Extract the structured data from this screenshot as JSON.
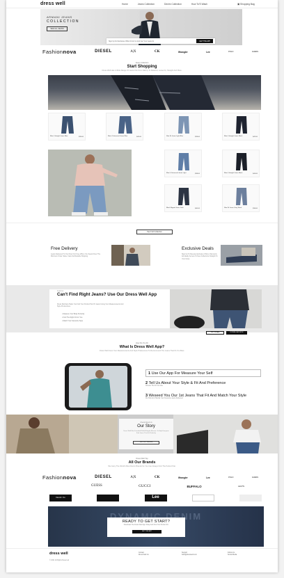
{
  "header": {
    "logo": "dress well",
    "nav": [
      "Home",
      "Jeans Collection",
      "Denim Collection",
      "How To'S Wash"
    ],
    "cart": "Shopping Bag"
  },
  "hero": {
    "subtitle": "ARMANI JEANS",
    "title": "COLLECTION",
    "button": "SEE ALL JEANS",
    "promo_text": "Sign Up For Exclusive Offers From Us And Get Your Jeans At",
    "promo_button": "GET THE APP"
  },
  "brands_row1": [
    "Fashion",
    "nova",
    "DIESEL",
    "A|X",
    "CK",
    "Wrangler",
    "Lee",
    "POLO",
    "GUESS"
  ],
  "start_shopping": {
    "label": "Jeans Collection",
    "title": "Start Shopping",
    "desc": "Dress Well Has A Wide Range Of Jeans Fits From Skinny To Relaxed, Loose Fit, Straight And More."
  },
  "products_top": [
    {
      "name": "Men's Straight Jeans Blue",
      "price": "$35.00"
    },
    {
      "name": "Men's Distressed Jeans Blue",
      "price": "$45.00"
    },
    {
      "name": "Slim Fit Jeans Light Blue",
      "price": "$39.00"
    },
    {
      "name": "Men's Straight Jeans Black",
      "price": "$42.00"
    }
  ],
  "products_side": [
    {
      "name": "Men's Distressed Jeans Light",
      "price": "$38.00"
    },
    {
      "name": "Men's Straight Jeans Black",
      "price": "$44.00"
    },
    {
      "name": "Black Ripped Jeans Dark",
      "price": "$40.00"
    },
    {
      "name": "Slim Fit Jeans Grey Wash",
      "price": "$36.00"
    }
  ],
  "see_collection": "See Full Collection",
  "features": [
    {
      "title": "Free Delivery",
      "desc": "Jeans Delivered To Your Door For Free When You Spend Over The Minimum Order Value. Fast And Reliable Shipping."
    },
    {
      "title": "Exclusive Deals",
      "desc": "Sign Up To Receive Exclusive Offers, Discounts And Early Access To New Collections Straight To Your Inbox."
    }
  ],
  "app": {
    "label": "Features",
    "title": "Can't Find Right Jeans? Use Our Dress Well App",
    "desc": "Dress Well App Helps You Find Your Perfect Pair Of Jeans Using Your Measurements And Style Preferences.",
    "bullets": [
      "Measure Your Body Perfectly",
      "Find The Right Fit For You",
      "Match Your Favourite Style"
    ],
    "store_btn1": "Get The App",
    "store_btn2": "DOWNLOAD NOW"
  },
  "how": {
    "label": "How Do You Fit",
    "title": "What Is Dress Well App?",
    "desc": "Dress Well Uses Your Measurements And Style Preferences To Recommend The Jeans That Fit You Best.",
    "steps": [
      {
        "title": "Use Our App For Measure Your Self",
        "desc": ""
      },
      {
        "title": "Tell Us About Your Style & Fit And Preference",
        "desc": "Choose The Fit You Like"
      },
      {
        "title": "Weseed You Our 1st Jeans That Fit And Match Your Style",
        "desc": "We Ship And Handle Your Favourite Jeans Delivered"
      }
    ]
  },
  "story": {
    "label": "Check About Us",
    "title": "Our Story",
    "desc": "Dress Well Was Founded With A Simple Mission: To Help Everyone Find Jeans That Fit Perfectly.",
    "button": "See Full Collection"
  },
  "all_brands": {
    "label": "Dress Well Top",
    "title": "All Our Brands",
    "desc": "We Carry The World's Best Denim Brands So You Can Always Find The Perfect Pair.",
    "row1": [
      "Fashion",
      "nova",
      "DIESEL",
      "A|X",
      "CK",
      "Wrangler",
      "Lee",
      "POLO",
      "GUESS"
    ],
    "row2": [
      "GUESS",
      "GUCCI",
      "BUFFALO",
      "LEVI'S"
    ],
    "row3": [
      "Denim Co",
      "",
      "Lee",
      "",
      ""
    ]
  },
  "cta": {
    "bg_word": "DYNAMIC DENIM",
    "title": "READY TO GET START?",
    "desc": "Download The Dress Well App Today And Find Your Perfect Fit.",
    "button": "GET THE APP"
  },
  "footer": {
    "logo": "dress well",
    "copyright": "© 2021 All Rights Reserved",
    "col1": [
      "Contact",
      "Dress Well Co."
    ],
    "col2": [
      "Support",
      "hello@dresswell.com"
    ],
    "col3": [
      "Follow Us",
      "Social Media"
    ]
  }
}
